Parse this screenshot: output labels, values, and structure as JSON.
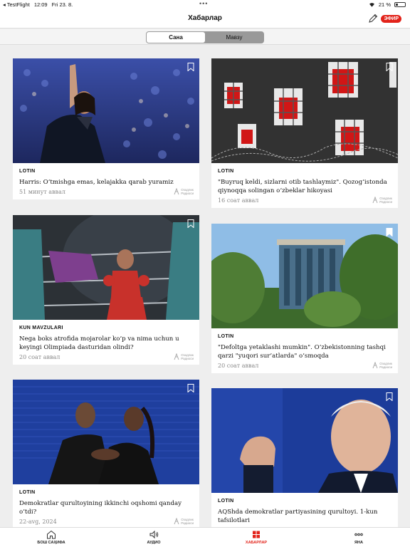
{
  "status": {
    "back_app": "TestFlight",
    "time": "12:09",
    "date": "Fri 23. 8.",
    "battery": "21 %",
    "battery_level": 0.21,
    "dots": "•••"
  },
  "header": {
    "title": "Хабарлар",
    "live": "ЭФИР"
  },
  "segments": [
    {
      "label": "Сана",
      "active": true
    },
    {
      "label": "Мавзу",
      "active": false
    }
  ],
  "logo_text": [
    "Озодлик",
    "Радиоси"
  ],
  "articles": [
    {
      "tag": "LOTIN",
      "headline": "Harris: O‘tmishga emas, kelajakka qarab yuramiz",
      "time": "51 минут аввал",
      "bookmarked": false
    },
    {
      "tag": "LOTIN",
      "headline": "\"Buyruq keldi, sizlarni otib tashlaymiz\". Qozog‘istonda qiynoqqa solingan o‘zbeklar hikoyasi",
      "time": "16 соат аввал",
      "bookmarked": false
    },
    {
      "tag": "KUN MAVZULARI",
      "headline": "Nega boks atrofida mojarolar ko‘p va nima uchun u keyingi Olimpiada dasturidan olindi?",
      "time": "20 соат аввал",
      "bookmarked": false
    },
    {
      "tag": "LOTIN",
      "headline": "\"Defoltga yetaklashi mumkin\". O‘zbekistonning tashqi qarzi \"yuqori sur’atlarda\" o‘smoqda",
      "time": "20 соат аввал",
      "bookmarked": true
    },
    {
      "tag": "LOTIN",
      "headline": "Demokratlar qurultoyining ikkinchi oqshomi qanday o‘tdi?",
      "time": "22-avg, 2024",
      "bookmarked": false
    },
    {
      "tag": "LOTIN",
      "headline": "AQShda demokratlar partiyasining qurultoyi. 1-kun tafsilotlari",
      "time": "",
      "bookmarked": false
    }
  ],
  "tabs": [
    {
      "label": "БОШ САҲИФА",
      "icon": "home-icon",
      "active": false
    },
    {
      "label": "АУДИО",
      "icon": "speaker-icon",
      "active": false
    },
    {
      "label": "ХАБАРЛАР",
      "icon": "grid-icon",
      "active": true
    },
    {
      "label": "ЯНА",
      "icon": "more-icon",
      "active": false
    }
  ],
  "colors": {
    "accent": "#e2231a",
    "background": "#eeeeee"
  }
}
